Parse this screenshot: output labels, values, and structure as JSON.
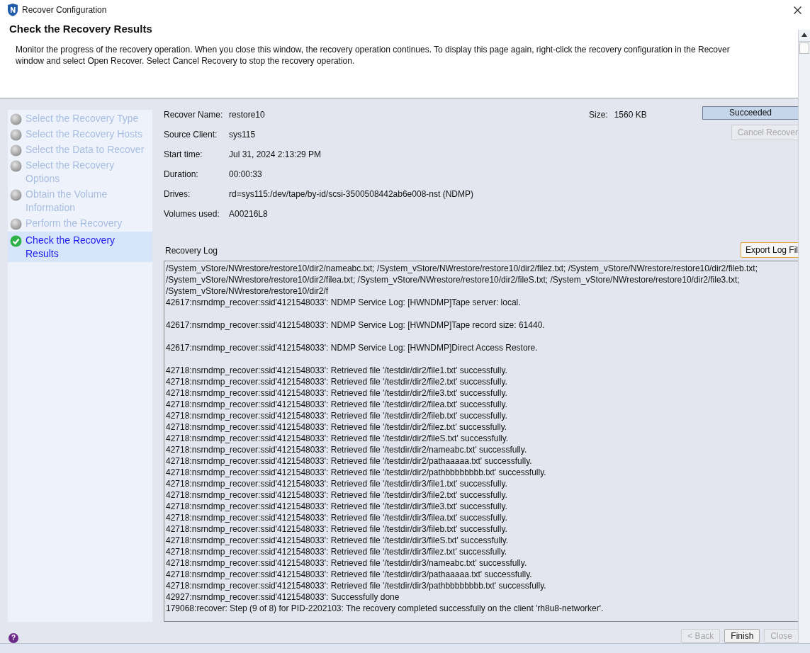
{
  "window": {
    "title": "Recover Configuration"
  },
  "header": {
    "title": "Check the Recovery Results",
    "description": "Monitor the progress of the recovery operation. When you close this window, the recovery operation continues. To display this page again, right-click the recovery configuration in the Recover window and select Open Recover. Select Cancel Recovery to stop the recovery operation."
  },
  "steps": [
    {
      "label": "Select the Recovery Type",
      "selected": false,
      "checked": false
    },
    {
      "label": "Select the Recovery Hosts",
      "selected": false,
      "checked": false
    },
    {
      "label": "Select the Data to Recover",
      "selected": false,
      "checked": false
    },
    {
      "label": "Select the Recovery Options",
      "selected": false,
      "checked": false
    },
    {
      "label": "Obtain the Volume Information",
      "selected": false,
      "checked": false
    },
    {
      "label": "Perform the Recovery",
      "selected": false,
      "checked": false
    },
    {
      "label": "Check the Recovery Results",
      "selected": true,
      "checked": true
    }
  ],
  "details": [
    {
      "label": "Recover Name:",
      "value": "restore10"
    },
    {
      "label": "Source Client:",
      "value": "sys115"
    },
    {
      "label": "Start time:",
      "value": "Jul 31, 2024 2:13:29 PM"
    },
    {
      "label": "Duration:",
      "value": "00:00:33"
    },
    {
      "label": "Drives:",
      "value": "rd=sys115:/dev/tape/by-id/scsi-3500508442ab6e008-nst (NDMP)"
    },
    {
      "label": "Volumes used:",
      "value": "A00216L8"
    }
  ],
  "size": {
    "label": "Size:",
    "value": "1560 KB"
  },
  "status": "Succeeded",
  "cancel_button": {
    "label": "Cancel Recover",
    "disabled": true
  },
  "log": {
    "title": "Recovery Log",
    "export_button": "Export Log Fil",
    "paragraphs": [
      [
        "/System_vStore/NWrestore/restore10/dir2/nameabc.txt; /System_vStore/NWrestore/restore10/dir2/filez.txt; /System_vStore/NWrestore/restore10/dir2/fileb.txt;",
        "/System_vStore/NWrestore/restore10/dir2/filea.txt; /System_vStore/NWrestore/restore10/dir2/fileS.txt; /System_vStore/NWrestore/restore10/dir2/file3.txt;",
        "/System_vStore/NWrestore/restore10/dir2/f",
        "42617:nsrndmp_recover:ssid'4121548033': NDMP Service Log: [HWNDMP]Tape server: local."
      ],
      [
        "42617:nsrndmp_recover:ssid'4121548033': NDMP Service Log: [HWNDMP]Tape record size: 61440."
      ],
      [
        "42617:nsrndmp_recover:ssid'4121548033': NDMP Service Log: [HWNDMP]Direct Access Restore."
      ],
      [
        "42718:nsrndmp_recover:ssid'4121548033': Retrieved file '/testdir/dir2/file1.txt' successfully.",
        "42718:nsrndmp_recover:ssid'4121548033': Retrieved file '/testdir/dir2/file2.txt' successfully.",
        "42718:nsrndmp_recover:ssid'4121548033': Retrieved file '/testdir/dir2/file3.txt' successfully.",
        "42718:nsrndmp_recover:ssid'4121548033': Retrieved file '/testdir/dir2/filea.txt' successfully.",
        "42718:nsrndmp_recover:ssid'4121548033': Retrieved file '/testdir/dir2/fileb.txt' successfully.",
        "42718:nsrndmp_recover:ssid'4121548033': Retrieved file '/testdir/dir2/filez.txt' successfully.",
        "42718:nsrndmp_recover:ssid'4121548033': Retrieved file '/testdir/dir2/fileS.txt' successfully.",
        "42718:nsrndmp_recover:ssid'4121548033': Retrieved file '/testdir/dir2/nameabc.txt' successfully.",
        "42718:nsrndmp_recover:ssid'4121548033': Retrieved file '/testdir/dir2/pathaaaaa.txt' successfully.",
        "42718:nsrndmp_recover:ssid'4121548033': Retrieved file '/testdir/dir2/pathbbbbbbbb.txt' successfully.",
        "42718:nsrndmp_recover:ssid'4121548033': Retrieved file '/testdir/dir3/file1.txt' successfully.",
        "42718:nsrndmp_recover:ssid'4121548033': Retrieved file '/testdir/dir3/file2.txt' successfully.",
        "42718:nsrndmp_recover:ssid'4121548033': Retrieved file '/testdir/dir3/file3.txt' successfully.",
        "42718:nsrndmp_recover:ssid'4121548033': Retrieved file '/testdir/dir3/filea.txt' successfully.",
        "42718:nsrndmp_recover:ssid'4121548033': Retrieved file '/testdir/dir3/fileb.txt' successfully.",
        "42718:nsrndmp_recover:ssid'4121548033': Retrieved file '/testdir/dir3/fileS.txt' successfully.",
        "42718:nsrndmp_recover:ssid'4121548033': Retrieved file '/testdir/dir3/filez.txt' successfully.",
        "42718:nsrndmp_recover:ssid'4121548033': Retrieved file '/testdir/dir3/nameabc.txt' successfully.",
        "42718:nsrndmp_recover:ssid'4121548033': Retrieved file '/testdir/dir3/pathaaaaa.txt' successfully.",
        "42718:nsrndmp_recover:ssid'4121548033': Retrieved file '/testdir/dir3/pathbbbbbbbb.txt' successfully.",
        "42927:nsrndmp_recover:ssid'4121548033': Successfully done",
        "179068:recover: Step (9 of 8) for PID-2202103: The recovery completed successfully on the client 'rh8u8-networker'."
      ]
    ]
  },
  "help_icon": "?",
  "buttons": [
    {
      "label": "< Back",
      "disabled": true
    },
    {
      "label": "Finish",
      "disabled": false
    },
    {
      "label": "Close",
      "disabled": true
    }
  ]
}
